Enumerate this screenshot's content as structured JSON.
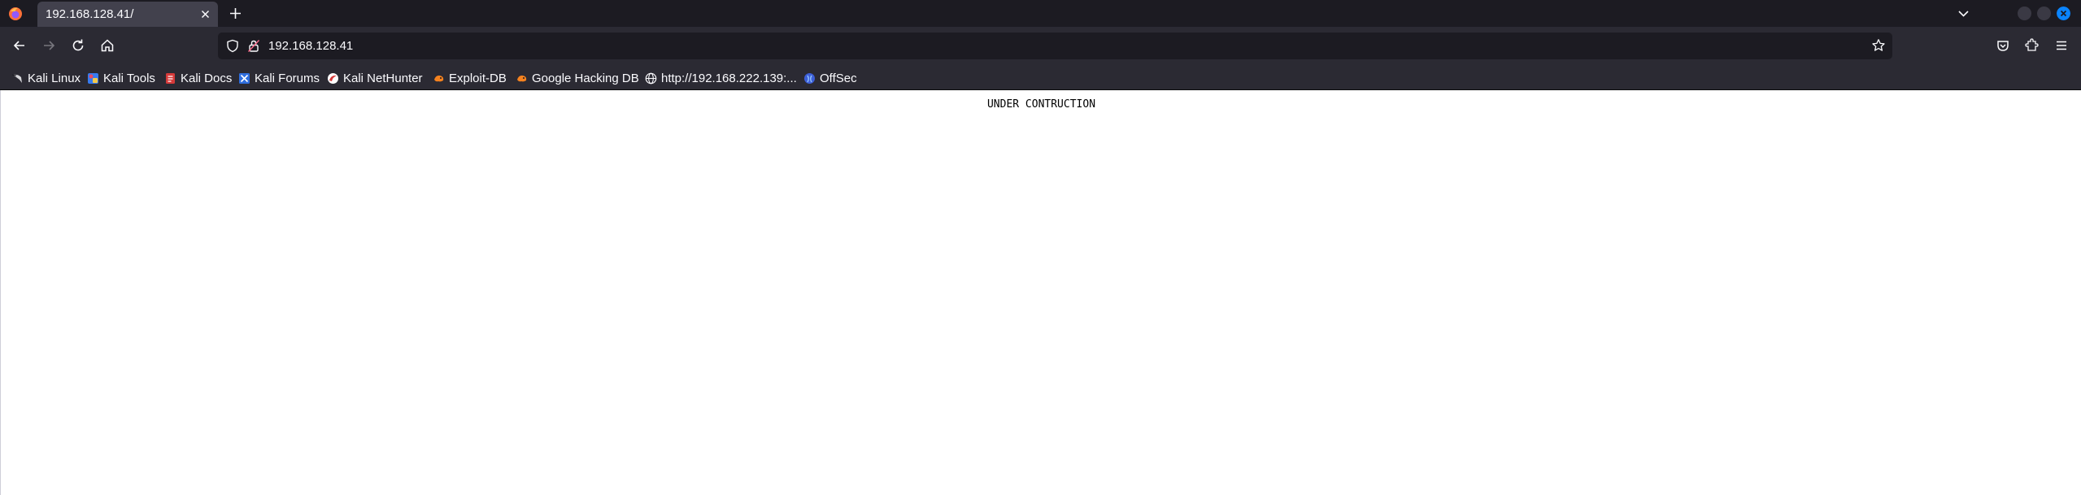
{
  "tab": {
    "title": "192.168.128.41/"
  },
  "urlbar": {
    "url": "192.168.128.41"
  },
  "bookmarks": [
    {
      "label": "Kali Linux",
      "icon": "kali-dragon-icon"
    },
    {
      "label": "Kali Tools",
      "icon": "kali-tools-icon"
    },
    {
      "label": "Kali Docs",
      "icon": "kali-docs-icon"
    },
    {
      "label": "Kali Forums",
      "icon": "kali-forums-icon"
    },
    {
      "label": "Kali NetHunter",
      "icon": "kali-nethunter-icon"
    },
    {
      "label": "Exploit-DB",
      "icon": "exploit-db-icon"
    },
    {
      "label": "Google Hacking DB",
      "icon": "ghdb-icon"
    },
    {
      "label": "http://192.168.222.139:...",
      "icon": "globe-icon"
    },
    {
      "label": "OffSec",
      "icon": "offsec-icon"
    }
  ],
  "page": {
    "text": "UNDER CONTRUCTION"
  },
  "colors": {
    "tabstrip": "#1c1b22",
    "toolbar": "#2b2a33",
    "active_tab": "#42414d",
    "urlbar": "#1c1b22",
    "accent_close": "#0a84ff",
    "page_background": "#ffffff"
  }
}
